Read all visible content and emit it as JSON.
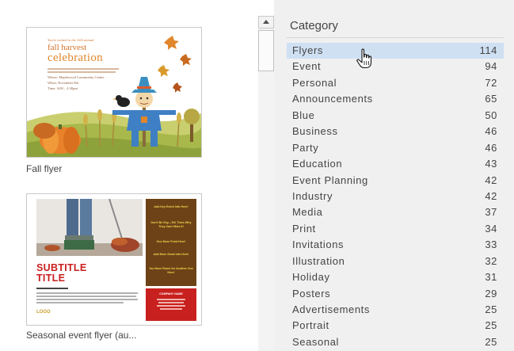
{
  "templates": [
    {
      "label": "Fall flyer",
      "art": {
        "invite_line": "You're invited to the 12th annual",
        "title_line1": "fall harvest",
        "title_line2": "celebration",
        "rows": [
          "Where:  Maplewood Community Centre",
          "When:  November 8th",
          "Time:  4:00 – 4:30pm"
        ]
      }
    },
    {
      "label": "Seasonal event flyer (au...",
      "art": {
        "subtitle": "SUBTITLE",
        "title": "TITLE",
        "logo": "LOGO",
        "side_blurbs": [
          "Add Key Event Info Here!",
          "Don't Be Shy—Tell Them Why They Can't Miss It!",
          "One More Point Here!",
          "Add More Great Info Here!",
          "You Have Room for Another One Here!"
        ],
        "company": "COMPANY NAME"
      }
    }
  ],
  "category_pane": {
    "header": "Category",
    "items": [
      {
        "name": "Flyers",
        "count": "114",
        "selected": true
      },
      {
        "name": "Event",
        "count": "94"
      },
      {
        "name": "Personal",
        "count": "72"
      },
      {
        "name": "Announcements",
        "count": "65"
      },
      {
        "name": "Blue",
        "count": "50"
      },
      {
        "name": "Business",
        "count": "46"
      },
      {
        "name": "Party",
        "count": "46"
      },
      {
        "name": "Education",
        "count": "43"
      },
      {
        "name": "Event Planning",
        "count": "42"
      },
      {
        "name": "Industry",
        "count": "42"
      },
      {
        "name": "Media",
        "count": "37"
      },
      {
        "name": "Print",
        "count": "34"
      },
      {
        "name": "Invitations",
        "count": "33"
      },
      {
        "name": "Illustration",
        "count": "32"
      },
      {
        "name": "Holiday",
        "count": "31"
      },
      {
        "name": "Posters",
        "count": "29"
      },
      {
        "name": "Advertisements",
        "count": "25"
      },
      {
        "name": "Portrait",
        "count": "25"
      },
      {
        "name": "Seasonal",
        "count": "25"
      }
    ]
  },
  "colors": {
    "selection": "#cfe0f3",
    "pane_background": "#f0f0f0",
    "accent_orange": "#e0872c",
    "accent_red": "#c8201e",
    "accent_brown": "#6e4217"
  },
  "icons": {
    "cursor": "hand-pointer-icon",
    "scroll_up": "chevron-up-icon"
  }
}
